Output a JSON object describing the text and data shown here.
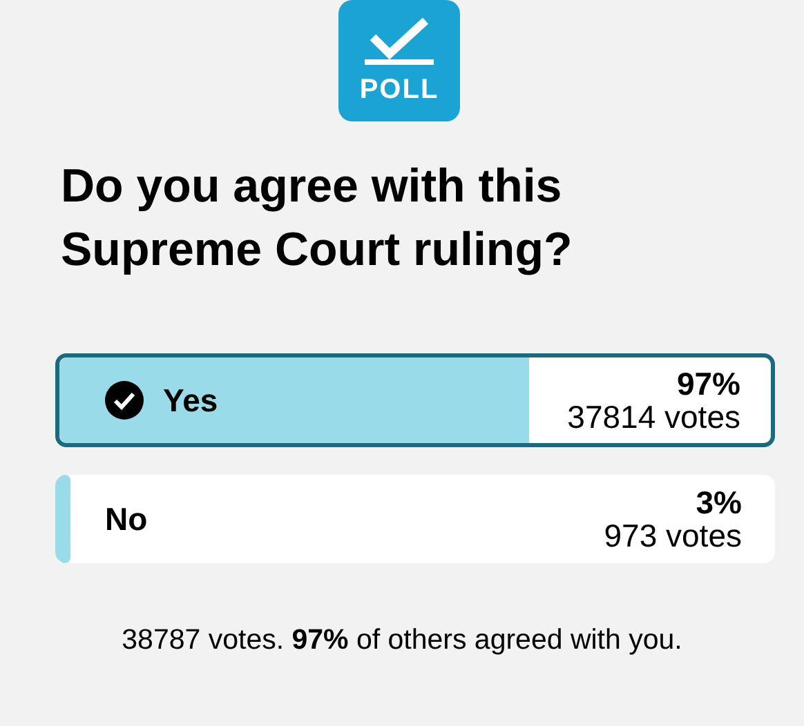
{
  "badge": {
    "label": "POLL"
  },
  "question": "Do you agree with this Supreme Court ruling?",
  "options": [
    {
      "label": "Yes",
      "selected": true,
      "percent": "97%",
      "votes": "37814 votes"
    },
    {
      "label": "No",
      "selected": false,
      "percent": "3%",
      "votes": "973 votes"
    }
  ],
  "summary": "38787 votes. **97%** of others agreed with you."
}
